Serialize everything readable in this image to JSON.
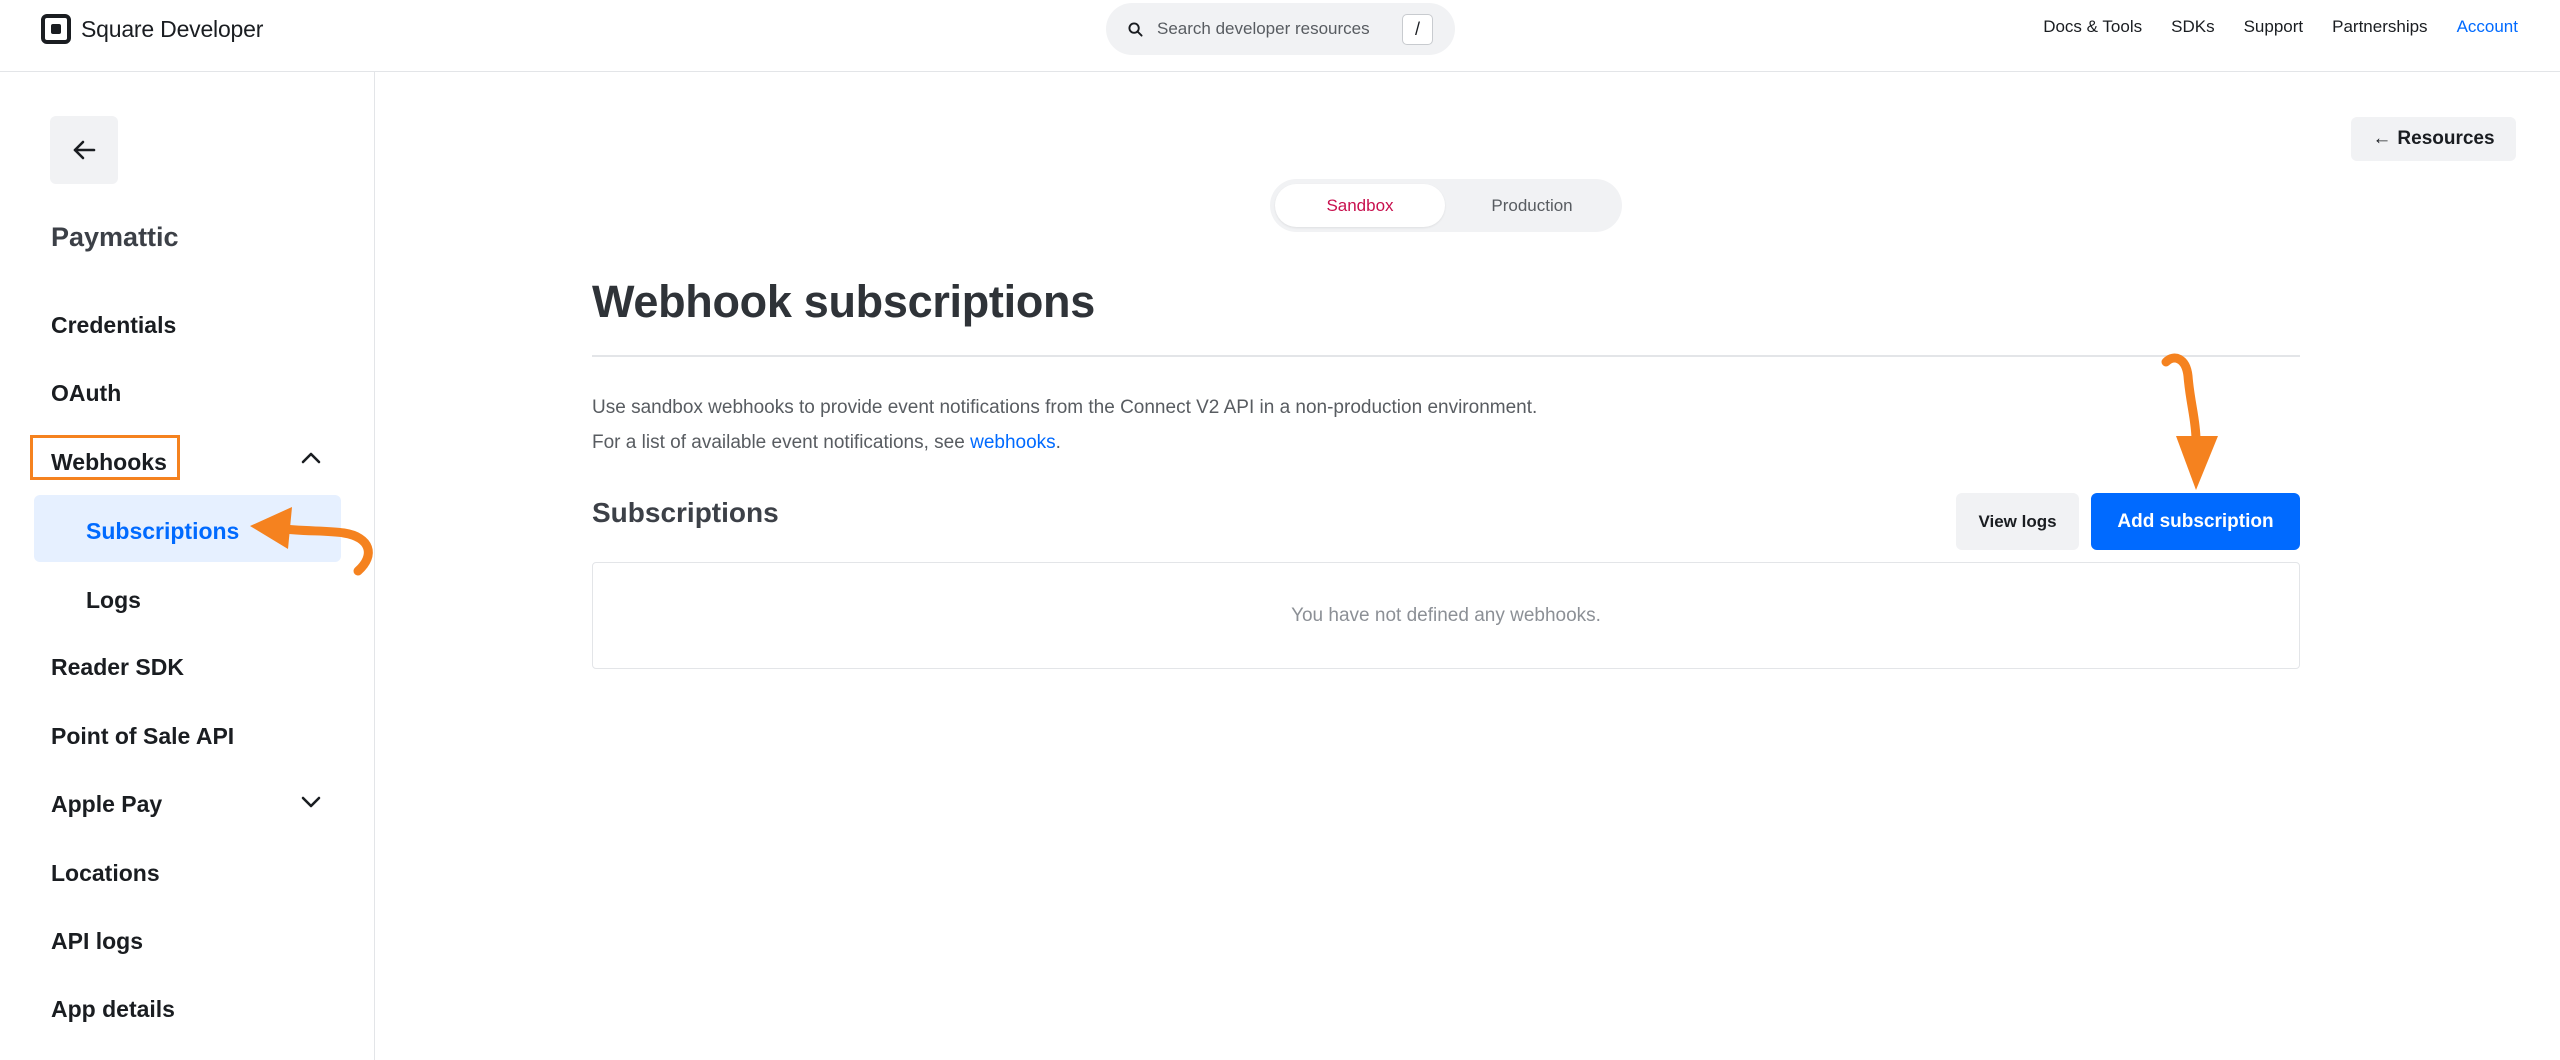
{
  "header": {
    "brand": "Square Developer",
    "search": {
      "placeholder": "Search developer resources",
      "shortcut": "/"
    },
    "nav": [
      "Docs & Tools",
      "SDKs",
      "Support",
      "Partnerships",
      "Account"
    ]
  },
  "sidebar": {
    "app_name": "Paymattic",
    "items": {
      "credentials": "Credentials",
      "oauth": "OAuth",
      "webhooks": "Webhooks",
      "subscriptions": "Subscriptions",
      "logs": "Logs",
      "reader_sdk": "Reader SDK",
      "pos_api": "Point of Sale API",
      "apple_pay": "Apple Pay",
      "locations": "Locations",
      "api_logs": "API logs",
      "app_details": "App details"
    }
  },
  "main": {
    "resources_label": "Resources",
    "env": {
      "sandbox": "Sandbox",
      "production": "Production",
      "selected": "Sandbox"
    },
    "title": "Webhook subscriptions",
    "description_before": "Use sandbox webhooks to provide event notifications from the Connect V2 API in a non-production environment. For a list of available event notifications, see ",
    "description_link": "webhooks",
    "description_after": ".",
    "subscriptions_heading": "Subscriptions",
    "view_logs_label": "View logs",
    "add_subscription_label": "Add subscription",
    "empty_message": "You have not defined any webhooks."
  },
  "colors": {
    "accent": "#006aff",
    "sandbox_text": "#c8104e",
    "annotation": "#f5821f"
  },
  "icons": [
    "search-icon",
    "arrow-left-icon",
    "chevron-up-icon",
    "chevron-down-icon"
  ]
}
